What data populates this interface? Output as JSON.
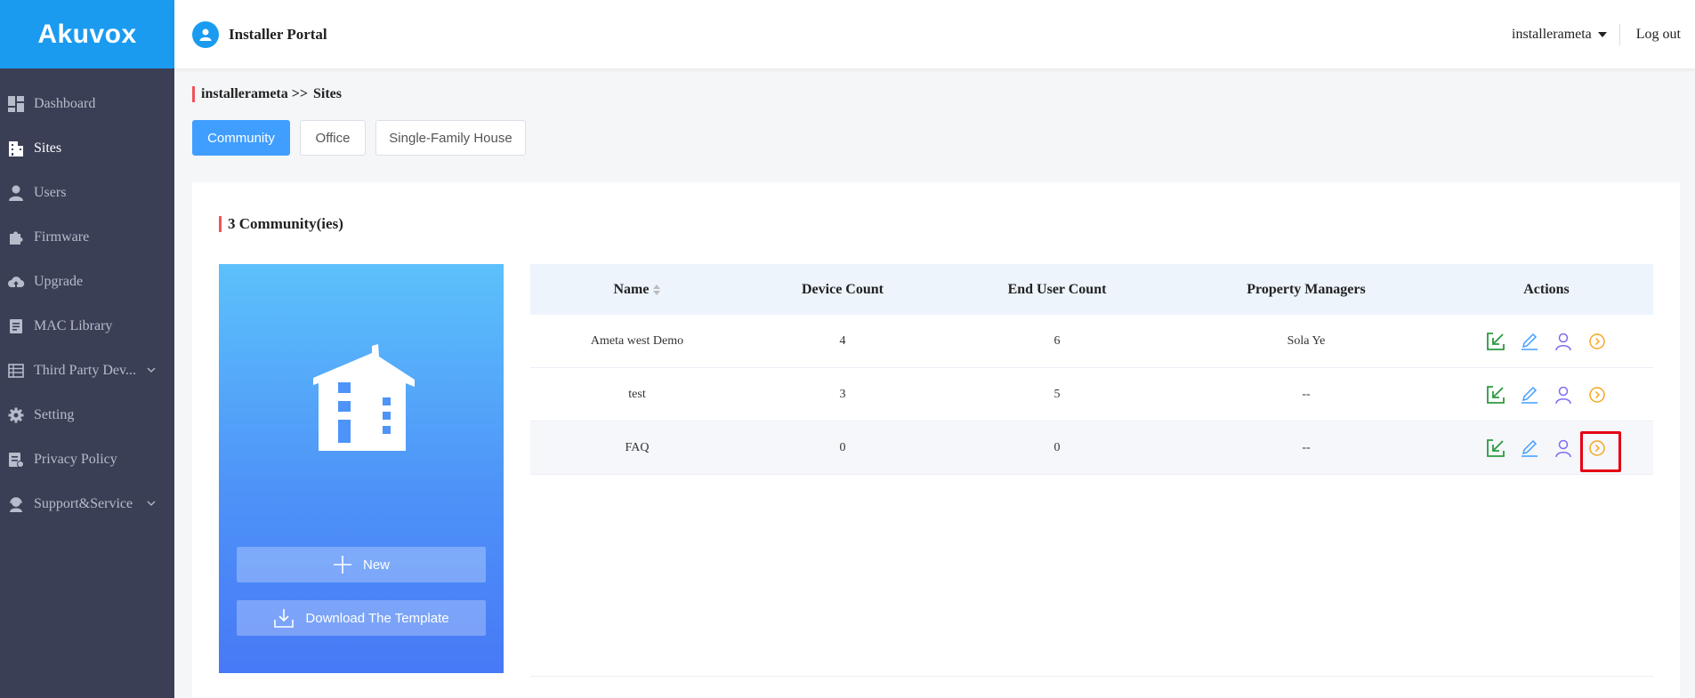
{
  "brand": {
    "logo": "Akuvox",
    "accent": "#1a9bf0"
  },
  "header": {
    "title": "Installer Portal",
    "username": "installerameta",
    "logout_label": "Log out"
  },
  "sidebar": {
    "items": [
      {
        "label": "Dashboard",
        "icon": "dashboard-icon"
      },
      {
        "label": "Sites",
        "icon": "sites-icon",
        "active": true
      },
      {
        "label": "Users",
        "icon": "user-icon"
      },
      {
        "label": "Firmware",
        "icon": "puzzle-icon"
      },
      {
        "label": "Upgrade",
        "icon": "cloud-upload-icon"
      },
      {
        "label": "MAC Library",
        "icon": "document-icon"
      },
      {
        "label": "Third Party Dev...",
        "icon": "grid-icon",
        "expandable": true
      },
      {
        "label": "Setting",
        "icon": "gear-icon"
      },
      {
        "label": "Privacy Policy",
        "icon": "policy-icon"
      },
      {
        "label": "Support&Service",
        "icon": "headset-icon",
        "expandable": true
      }
    ]
  },
  "breadcrumb": {
    "root": "installerameta",
    "separator": ">>",
    "current": "Sites"
  },
  "tabs": [
    {
      "label": "Community",
      "active": true
    },
    {
      "label": "Office"
    },
    {
      "label": "Single-Family House"
    }
  ],
  "section": {
    "title": "3 Community(ies)"
  },
  "promo": {
    "new_label": "New",
    "download_label": "Download The Template"
  },
  "table": {
    "columns": [
      "Name",
      "Device Count",
      "End User Count",
      "Property Managers",
      "Actions"
    ],
    "rows": [
      {
        "name": "Ameta west Demo",
        "device_count": "4",
        "end_user_count": "6",
        "property_managers": "Sola Ye"
      },
      {
        "name": "test",
        "device_count": "3",
        "end_user_count": "5",
        "property_managers": "--"
      },
      {
        "name": "FAQ",
        "device_count": "0",
        "end_user_count": "0",
        "property_managers": "--"
      }
    ],
    "action_icons": [
      "enter-icon",
      "edit-icon",
      "manager-icon",
      "go-icon"
    ],
    "action_colors": {
      "enter": "#2c9a3f",
      "edit": "#409eff",
      "manager": "#7b6cf0",
      "go": "#f5a623"
    },
    "highlight_color": "#e60012"
  }
}
